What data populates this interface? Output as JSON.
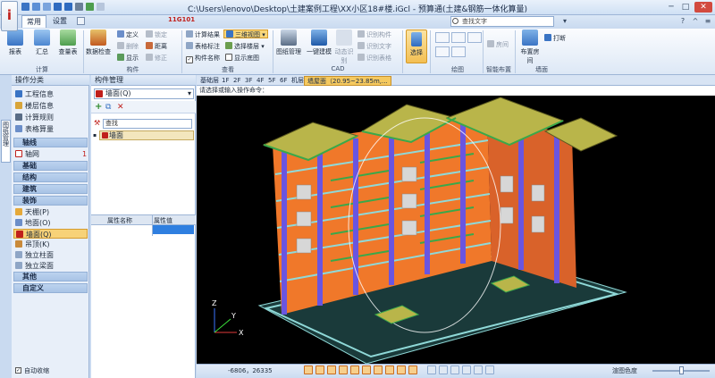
{
  "window": {
    "title": "C:\\Users\\lenovo\\Desktop\\土建案例工程\\XX小区18#楼.iGcl - 预算通(土建&钢筋一体化算量)",
    "code_label": "11G101",
    "tabs": [
      "常用",
      "设置"
    ],
    "search_placeholder": "查找文字"
  },
  "ribbon": {
    "groups": [
      {
        "name": "计算",
        "buttons": [
          "报表",
          "汇总",
          "查量表"
        ]
      },
      {
        "name": "构件",
        "buttons": [
          "数据检查",
          "定义",
          "删除",
          "显示",
          "锁定",
          "距离",
          "修正"
        ]
      },
      {
        "name": "查看",
        "buttons": [
          "计算结果",
          "表格标注",
          "构件名称",
          "三维视图",
          "选择楼层",
          "显示底图"
        ]
      },
      {
        "name": "CAD",
        "buttons": [
          "图纸管理",
          "一键建模",
          "识别构件",
          "识别文字",
          "识别表格",
          "动态识别"
        ]
      },
      {
        "name": "绘图",
        "buttons": [
          "选择"
        ]
      },
      {
        "name": "智能布置",
        "buttons": [
          "房间"
        ]
      },
      {
        "name": "墙面",
        "buttons": [
          "布置房间",
          "打断"
        ]
      }
    ]
  },
  "left_panel": {
    "header": "操作分类",
    "side_tab": "图纸管理",
    "top_items": [
      "工程信息",
      "楼层信息",
      "计算规则",
      "表格算量"
    ],
    "categories": [
      {
        "name": "轴线",
        "items": [
          {
            "label": "轴网",
            "count": "1"
          }
        ]
      },
      {
        "name": "基础",
        "items": []
      },
      {
        "name": "结构",
        "items": []
      },
      {
        "name": "建筑",
        "items": []
      },
      {
        "name": "装饰",
        "items": [
          {
            "label": "天棚(P)",
            "count": ""
          },
          {
            "label": "地面(O)",
            "count": ""
          },
          {
            "label": "墙面(Q)",
            "count": ""
          },
          {
            "label": "吊顶(K)",
            "count": ""
          },
          {
            "label": "独立柱面",
            "count": ""
          },
          {
            "label": "独立梁面",
            "count": ""
          }
        ]
      },
      {
        "name": "其他",
        "items": []
      },
      {
        "name": "自定义",
        "items": []
      }
    ],
    "auto_hide": "自动收缩"
  },
  "component_panel": {
    "header": "构件管理",
    "selected_type": "墙面(Q)",
    "search_placeholder": "查找",
    "items": [
      "墙面"
    ],
    "prop_headers": [
      "属性名称",
      "属性值"
    ]
  },
  "view": {
    "floor_tabs": [
      "基础层",
      "1F",
      "2F",
      "3F",
      "4F",
      "5F",
      "6F",
      "机层",
      "墙屋面"
    ],
    "current_component": "墙屋面（20.95~23.85m,...",
    "command_prompt": "请选择或输入操作命令：",
    "axis_labels": [
      "Z",
      "X",
      "Y"
    ]
  },
  "status": {
    "coords": "-6806，26335",
    "render_mode": "渲图色度"
  },
  "colors": {
    "wall": "#f0782a",
    "roof": "#b9b54a",
    "column": "#6a55e0",
    "stair": "#d7d7d7",
    "ground": "#8fd9d8",
    "accent": "#d59a27"
  }
}
